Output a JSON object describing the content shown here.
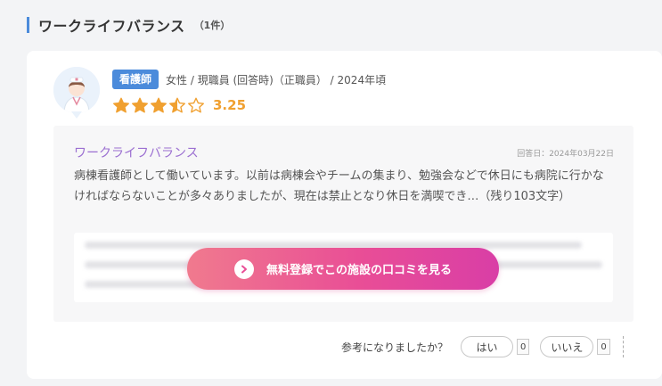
{
  "section": {
    "title": "ワークライフバランス",
    "count": "（1件）"
  },
  "review": {
    "role_badge": "看護師",
    "meta": "女性 / 現職員 (回答時)（正職員） / 2024年頃",
    "rating": "3.25",
    "rating_value": 3.25,
    "rating_max": 5,
    "accent_color": "#f0a030",
    "title": "ワークライフバランス",
    "date": "回答日：2024年03月22日",
    "body": "病棟看護師として働いています。以前は病棟会やチームの集まり、勉強会などで休日にも病院に行かなければならないことが多々ありましたが、現在は禁止となり休日を満喫でき…（残り103文字）",
    "cta_label": "無料登録でこの施設の口コミを見る",
    "cta_icon": "chevron-right-icon"
  },
  "helpful": {
    "question": "参考になりましたか？",
    "yes_label": "はい",
    "yes_count": "0",
    "no_label": "いいえ",
    "no_count": "0"
  }
}
